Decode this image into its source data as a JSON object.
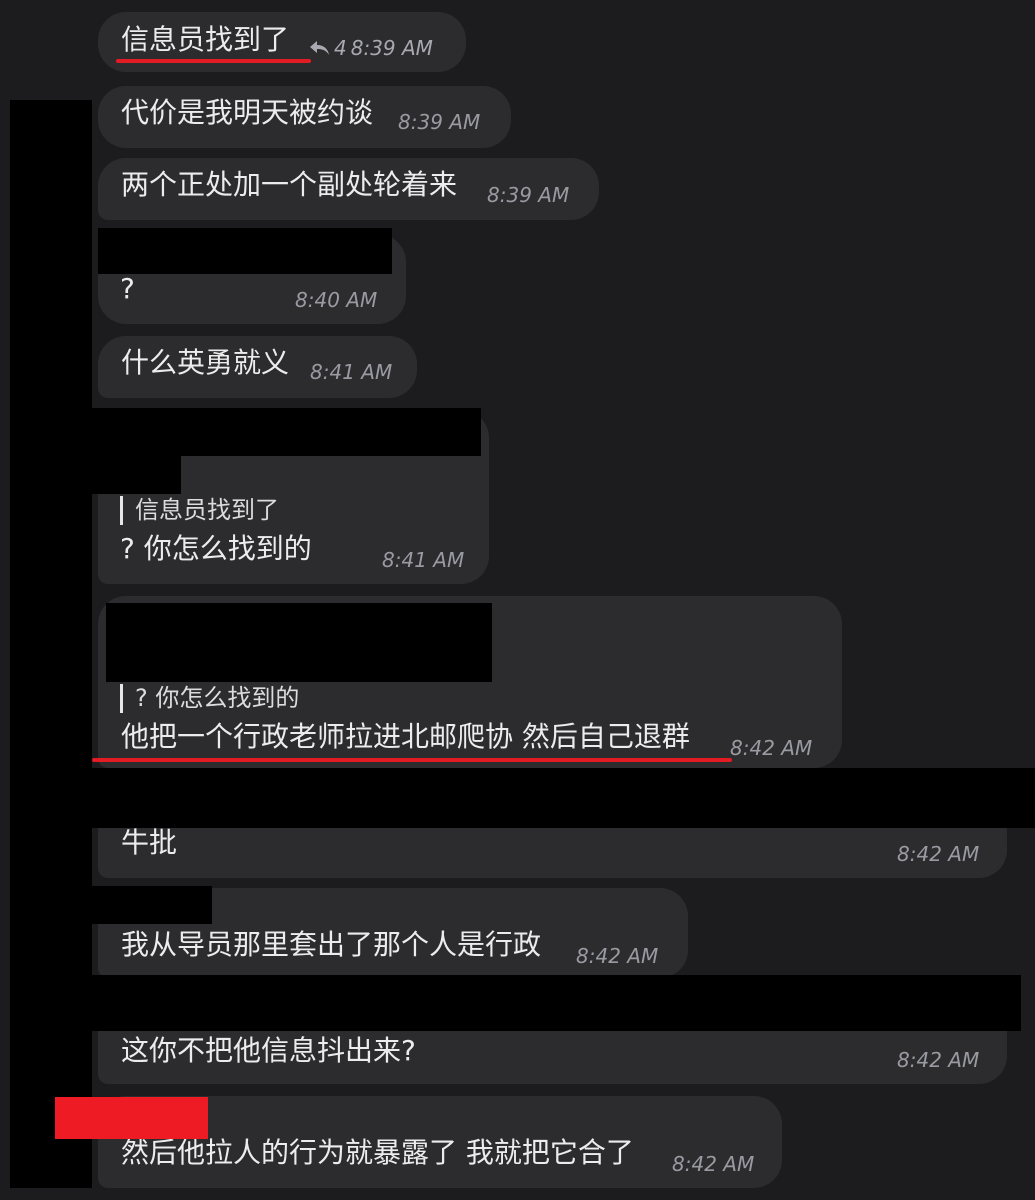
{
  "messages": [
    {
      "text": "信息员找到了",
      "time": "8:39 AM",
      "reply_count": "4"
    },
    {
      "text": "代价是我明天被约谈",
      "time": "8:39 AM"
    },
    {
      "text": "两个正处加一个副处轮着来",
      "time": "8:39 AM"
    },
    {
      "text": "?",
      "time": "8:40 AM"
    },
    {
      "text": "什么英勇就义",
      "time": "8:41 AM"
    },
    {
      "quote": "信息员找到了",
      "text": "? 你怎么找到的",
      "time": "8:41 AM"
    },
    {
      "quote": "? 你怎么找到的",
      "text": "他把一个行政老师拉进北邮爬协 然后自己退群",
      "time": "8:42 AM"
    },
    {
      "text": "牛批",
      "time": "8:42 AM"
    },
    {
      "text": "我从导员那里套出了那个人是行政",
      "time": "8:42 AM"
    },
    {
      "text": "这你不把他信息抖出来?",
      "time": "8:42 AM"
    },
    {
      "text": "然后他拉人的行为就暴露了 我就把它合了",
      "time": "8:42 AM"
    }
  ],
  "colors": {
    "background": "#1c1c1e",
    "bubble": "#2c2c2e",
    "text": "#ececec",
    "timestamp": "#9a9aa3",
    "annotation_underline": "#e31b23",
    "redaction": "#000000",
    "redaction_red": "#ee1b24"
  },
  "icons": {
    "reply": "reply-arrow-icon"
  }
}
